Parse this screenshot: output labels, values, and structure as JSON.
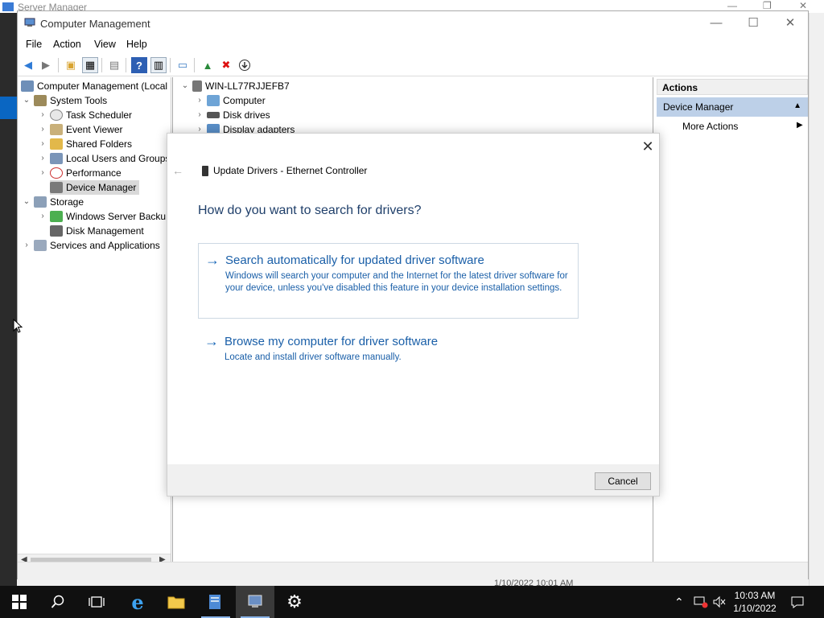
{
  "background": {
    "server_manager_title": "Server Manager",
    "timestamp_fragment": "1/10/2022 10:01 AM"
  },
  "window": {
    "title": "Computer Management",
    "min_glyph": "—",
    "max_glyph": "☐",
    "close_glyph": "✕"
  },
  "menu": {
    "file": "File",
    "action": "Action",
    "view": "View",
    "help": "Help"
  },
  "tree": {
    "root": "Computer Management (Local",
    "system_tools": "System Tools",
    "task_scheduler": "Task Scheduler",
    "event_viewer": "Event Viewer",
    "shared_folders": "Shared Folders",
    "local_users": "Local Users and Groups",
    "performance": "Performance",
    "device_manager": "Device Manager",
    "storage": "Storage",
    "windows_backup": "Windows Server Backu",
    "disk_management": "Disk Management",
    "services_apps": "Services and Applications"
  },
  "devices": {
    "host": "WIN-LL77RJJEFB7",
    "computer": "Computer",
    "disk_drives": "Disk drives",
    "display_adapters": "Display adapters"
  },
  "actions": {
    "header": "Actions",
    "section": "Device Manager",
    "more": "More Actions"
  },
  "dialog": {
    "title": "Update Drivers - Ethernet Controller",
    "heading": "How do you want to search for drivers?",
    "option1_title": "Search automatically for updated driver software",
    "option1_desc": "Windows will search your computer and the Internet for the latest driver software for your device, unless you've disabled this feature in your device installation settings.",
    "option2_title": "Browse my computer for driver software",
    "option2_desc": "Locate and install driver software manually.",
    "cancel": "Cancel",
    "arrow_glyph": "→",
    "close_glyph": "✕",
    "back_glyph": "←"
  },
  "taskbar": {
    "time": "10:03 AM",
    "date": "1/10/2022"
  },
  "colors": {
    "link_blue": "#1a5fa8",
    "heading_blue": "#1f3f6a",
    "selection": "#bdd0e8"
  }
}
